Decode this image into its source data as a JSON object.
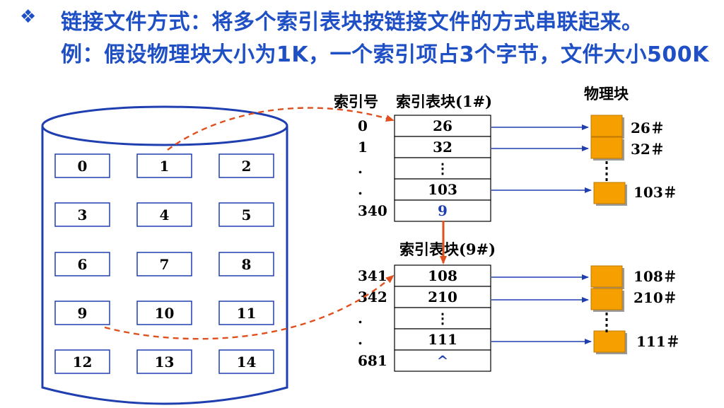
{
  "header": {
    "bullet": "❖",
    "line1": "链接文件方式：将多个索引表块按链接文件的方式串联起来。",
    "line2": "例：假设物理块大小为1K，一个索引项占3个字节，文件大小500K"
  },
  "disk": {
    "blocks": [
      "0",
      "1",
      "2",
      "3",
      "4",
      "5",
      "6",
      "7",
      "8",
      "9",
      "10",
      "11",
      "12",
      "13",
      "14"
    ]
  },
  "table1": {
    "header_index": "索引号",
    "title": "索引表块(1#)",
    "index_labels": [
      "0",
      "1",
      ".",
      ".",
      "340"
    ],
    "cells": [
      "26",
      "32",
      "⋮",
      "103",
      "9"
    ]
  },
  "table2": {
    "title": "索引表块(9#)",
    "index_labels": [
      "341",
      "342",
      ".",
      ".",
      "681"
    ],
    "cells": [
      "108",
      "210",
      "⋮",
      "111",
      "^"
    ]
  },
  "physical": {
    "title": "物理块",
    "blocks1": [
      "26＃",
      "32＃",
      "103＃"
    ],
    "blocks2": [
      "108＃",
      "210＃",
      "111＃"
    ]
  },
  "colors": {
    "blue_text": "#1f4fc4",
    "orange_block": "#f5a000",
    "red_dashed": "#e0501e",
    "blue_arrow": "#1f3fb0"
  }
}
